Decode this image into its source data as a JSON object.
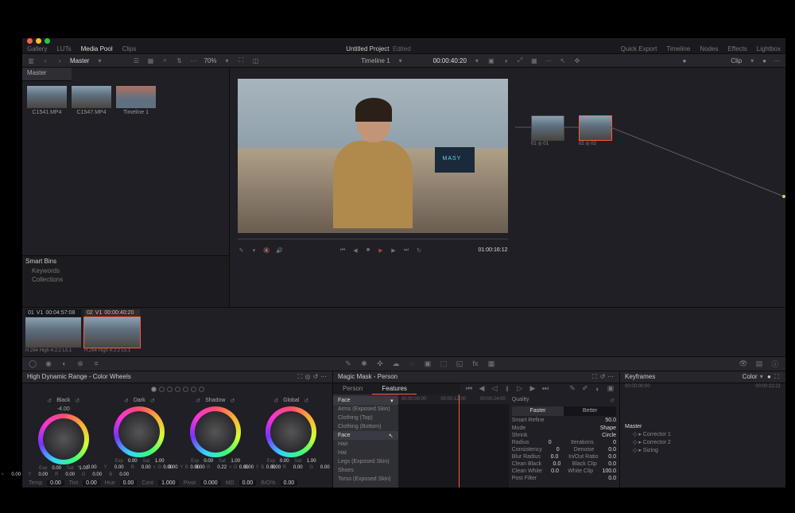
{
  "project": {
    "title": "Untitled Project",
    "status": "Edited"
  },
  "topmenu": {
    "gallery": "Gallery",
    "luts": "LUTs",
    "mediapool": "Media Pool",
    "clips": "Clips",
    "quickexport": "Quick Export",
    "timeline": "Timeline",
    "nodes": "Nodes",
    "effects": "Effects",
    "lightbox": "Lightbox"
  },
  "toolbar": {
    "master": "Master",
    "zoom": "70%",
    "timeline": "Timeline 1",
    "timecode": "00:00:40:20",
    "clip": "Clip"
  },
  "pool": {
    "tab": "Master",
    "thumbs": [
      {
        "label": "C1541.MP4"
      },
      {
        "label": "C1547.MP4"
      },
      {
        "label": "Timeline 1"
      }
    ],
    "smartbins": {
      "header": "Smart Bins",
      "items": [
        "Keywords",
        "Collections"
      ]
    }
  },
  "viewer": {
    "tc": "01:00:16:12",
    "laptop_text": "MASY"
  },
  "nodes": {
    "n1": "01",
    "n1i": "01",
    "n2": "02",
    "n2i": "02"
  },
  "clips": [
    {
      "num": "01",
      "trk": "V1",
      "tc": "00:04:57:08",
      "ft": "H.264 High 4:2:2 L5.1"
    },
    {
      "num": "02",
      "trk": "V1",
      "tc": "00:00:40:20",
      "ft": "H.264 High 4:2:2 L5.1"
    }
  ],
  "wheels": {
    "title": "High Dynamic Range - Color Wheels",
    "items": [
      {
        "name": "Black",
        "sub": "-4.00",
        "exp": "0.00",
        "sat": "1.00",
        "x": "0.00",
        "y": "0.00",
        "r": "0.00",
        "g": "0.00",
        "b": "0.00"
      },
      {
        "name": "Dark",
        "sub": "",
        "exp": "0.00",
        "sat": "1.00",
        "x": "0.00",
        "y": "0.00",
        "r": "0.00",
        "g": "0.00",
        "b": "0.00"
      },
      {
        "name": "Shadow",
        "sub": "",
        "exp": "0.00",
        "sat": "1.00",
        "x": "0.00",
        "y": "0.00",
        "r": "0.22",
        "g": "0.00",
        "b": "0.00"
      },
      {
        "name": "Global",
        "sub": "",
        "exp": "0.00",
        "sat": "1.00",
        "x": "0.00",
        "y": "0.00",
        "r": "0.00",
        "g": "0.00",
        "b": "0.00"
      }
    ],
    "footer": {
      "temp": "0.00",
      "tint": "0.00",
      "hue": "0.00",
      "cont": "1.000",
      "pivot": "0.000",
      "md": "0.00",
      "bo": "0.00"
    }
  },
  "magic": {
    "title": "Magic Mask - Person",
    "tabs": {
      "person": "Person",
      "features": "Features"
    },
    "current": "Face",
    "features": [
      "Arms (Exposed Skin)",
      "Clothing (Top)",
      "Clothing (Bottom)",
      "Face",
      "Hair",
      "Hat",
      "Legs (Exposed Skin)",
      "Shoes",
      "Torso (Exposed Skin)"
    ],
    "tltimes": [
      "00:00:00:00",
      "00:00:12:00",
      "00:00:24:00"
    ],
    "quality": {
      "label": "Quality",
      "faster": "Faster",
      "better": "Better"
    },
    "smart": {
      "label": "Smart Refine",
      "val": "50.0"
    },
    "props": [
      {
        "k": "Mode",
        "v": "Shape"
      },
      {
        "k": "Shrink",
        "v": "Circle"
      },
      {
        "k": "Radius",
        "k2": "Iterations",
        "v": "0",
        "v2": "0"
      },
      {
        "k": "Consistency",
        "k2": "Denoise",
        "v": "0",
        "v2": "0.0"
      },
      {
        "k": "Blur Radius",
        "k2": "In/Out Ratio",
        "v": "0.0",
        "v2": "0.0"
      },
      {
        "k": "Clean Black",
        "k2": "Black Clip",
        "v": "0.0",
        "v2": "0.0"
      },
      {
        "k": "Clean White",
        "k2": "White Clip",
        "v": "0.0",
        "v2": "100.0"
      },
      {
        "k": "Post Filter",
        "v": "0.0"
      }
    ]
  },
  "keyframes": {
    "title": "Keyframes",
    "mode": "Color",
    "start": "00:00:00:00",
    "end": "00:00:22:21",
    "tracks": {
      "master": "Master",
      "items": [
        "Corrector 1",
        "Corrector 2",
        "Sizing"
      ]
    }
  }
}
